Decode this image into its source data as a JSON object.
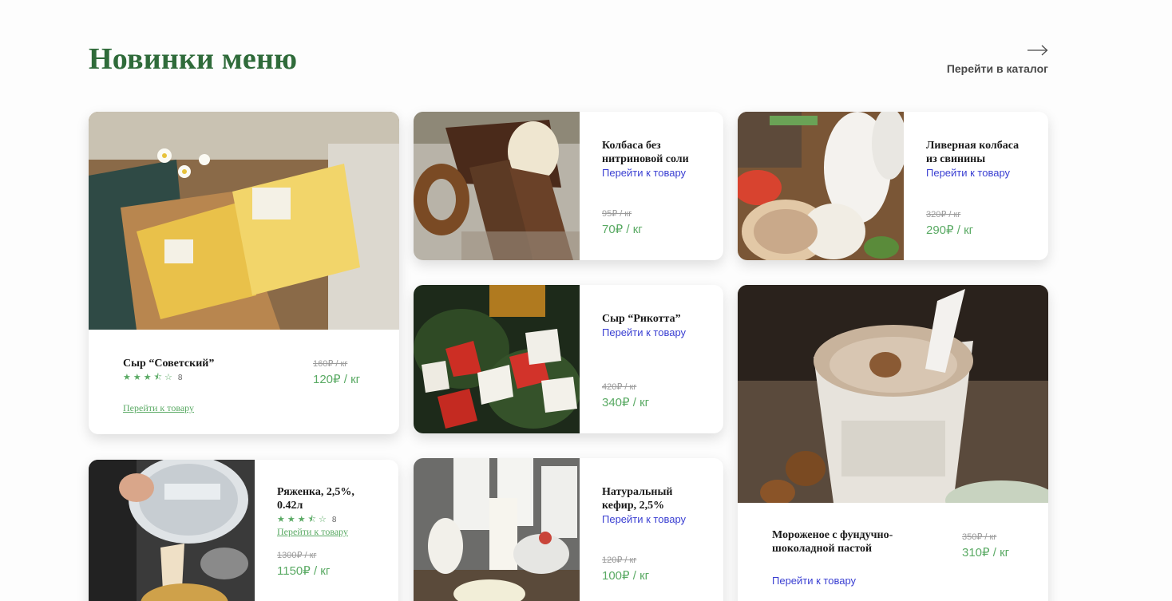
{
  "header": {
    "title": "Новинки меню",
    "catalog_link": "Перейти в каталог"
  },
  "icons": {
    "catalog": "arrow-right-icon",
    "star_filled": "star-icon",
    "star_half": "star-half-icon",
    "star_empty": "star-outline-icon"
  },
  "colors": {
    "title": "#2f6b3a",
    "price": "#5aaa64",
    "link": "#3a3fd2"
  },
  "products": {
    "sovetsky": {
      "title": "Сыр “Советский”",
      "rating": 3.5,
      "reviews": "8",
      "old_price": "160₽ / кг",
      "price": "120₽ / кг",
      "link": "Перейти к товару"
    },
    "kolbasa": {
      "title": "Колбаса без нитриновой соли",
      "old_price": "95₽ / кг",
      "price": "70₽ / кг",
      "link": "Перейти к товару"
    },
    "livernaya": {
      "title": "Ливерная колбаса из свинины",
      "old_price": "320₽ / кг",
      "price": "290₽ / кг",
      "link": "Перейти к товару"
    },
    "rikotta": {
      "title": "Сыр “Рикотта”",
      "old_price": "420₽ / кг",
      "price": "340₽ / кг",
      "link": "Перейти к товару"
    },
    "ryazhenka": {
      "title": "Ряженка, 2,5%, 0.42л",
      "rating": 3.5,
      "reviews": "8",
      "old_price": "1300₽ / кг",
      "price": "1150₽ / кг",
      "link": "Перейти к товару"
    },
    "kefir": {
      "title": "Натуральный кефир, 2,5%",
      "old_price": "120₽ / кг",
      "price": "100₽ / кг",
      "link": "Перейти к товару"
    },
    "morozhenoe": {
      "title": "Мороженое с фундучно-шоколадной пастой",
      "old_price": "350₽ / кг",
      "price": "310₽ / кг",
      "link": "Перейти к товару"
    }
  }
}
